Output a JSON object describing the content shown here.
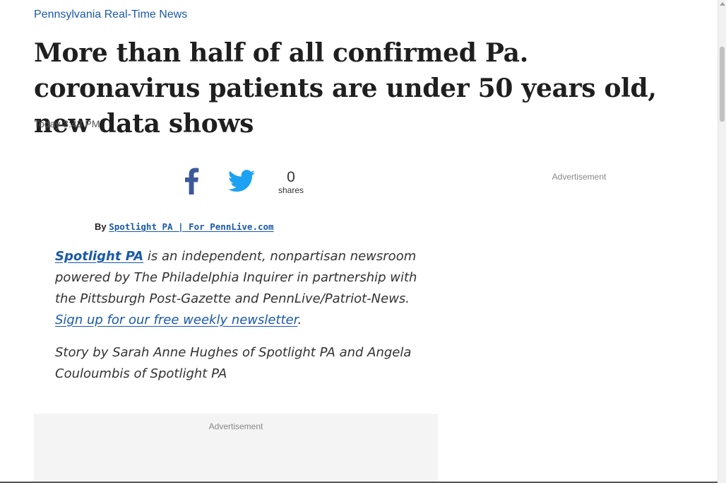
{
  "section": {
    "label": "Pennsylvania Real-Time News"
  },
  "article": {
    "headline": "More than half of all confirmed Pa. coronavirus patients are under 50 years old, new data shows",
    "timestamp": "Today 3:43 PM",
    "byline_prefix": "By",
    "byline_author": "Spotlight PA | For PennLive.com",
    "intro_brand": "Spotlight PA",
    "intro_text": " is an independent, nonpartisan newsroom powered by The Philadelphia Inquirer in partnership with the Pittsburgh Post-Gazette and PennLive/Patriot-News. ",
    "intro_signup": "Sign up for our free weekly newsletter",
    "intro_end": ".",
    "story_credit": "Story by Sarah Anne Hughes of Spotlight PA and Angela Couloumbis of Spotlight PA"
  },
  "share": {
    "count": "0",
    "label": "shares",
    "facebook_icon": "facebook-icon",
    "twitter_icon": "twitter-icon"
  },
  "ads": {
    "right_label": "Advertisement",
    "inline_label": "Advertisement"
  },
  "colors": {
    "link": "#1a5aa8",
    "facebook": "#3b5998",
    "twitter": "#1da1f2",
    "ad_background": "#f4f4f4"
  }
}
